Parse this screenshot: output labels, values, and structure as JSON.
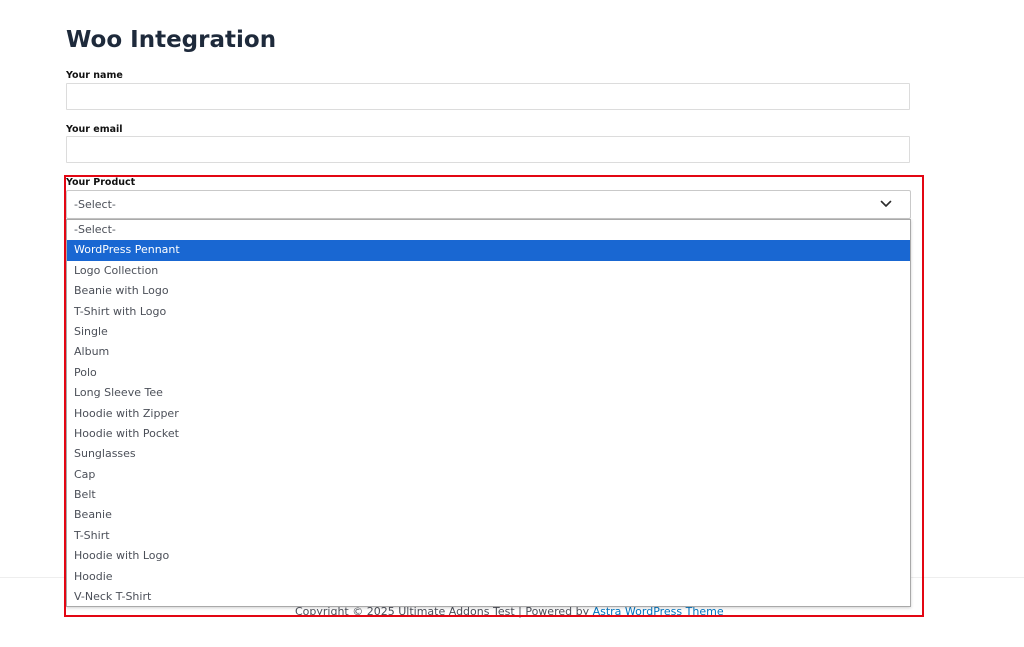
{
  "page": {
    "title": "Woo Integration"
  },
  "form": {
    "name_label": "Your name",
    "name_value": "",
    "email_label": "Your email",
    "email_value": "",
    "product_label": "Your Product",
    "product_selected": "-Select-",
    "product_options": [
      "-Select-",
      "WordPress Pennant",
      "Logo Collection",
      "Beanie with Logo",
      "T-Shirt with Logo",
      "Single",
      "Album",
      "Polo",
      "Long Sleeve Tee",
      "Hoodie with Zipper",
      "Hoodie with Pocket",
      "Sunglasses",
      "Cap",
      "Belt",
      "Beanie",
      "T-Shirt",
      "Hoodie with Logo",
      "Hoodie",
      "V-Neck T-Shirt"
    ],
    "highlighted_option_index": 1,
    "dropdown_icon": "chevron-down-icon"
  },
  "footer": {
    "copyright": "Copyright © 2025 Ultimate Addons Test | Powered by ",
    "link_text": "Astra WordPress Theme"
  },
  "colors": {
    "highlight_border": "#e30613",
    "selected_option_bg": "#1967d2",
    "link": "#0274be"
  }
}
